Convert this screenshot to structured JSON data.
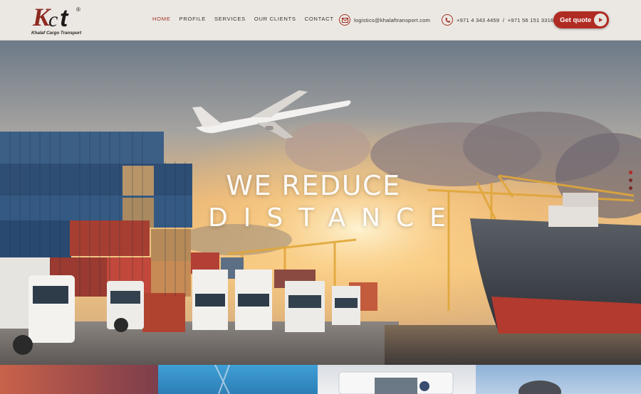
{
  "brand": {
    "logo_letters": "KCt",
    "registered_mark": "®",
    "company_name": "Khalaf Cargo Transport"
  },
  "nav": {
    "items": [
      {
        "label": "HOME",
        "active": true
      },
      {
        "label": "PROFILE",
        "active": false
      },
      {
        "label": "SERVICES",
        "active": false
      },
      {
        "label": "OUR CLIENTS",
        "active": false
      },
      {
        "label": "CONTACT",
        "active": false
      }
    ]
  },
  "contact": {
    "email_icon": "envelope-icon",
    "email": "logistics@khalaftransport.com",
    "phone_icon": "phone-icon",
    "phones": "+971 4 343 4459  /  +971 56 151 3316"
  },
  "cta": {
    "label": "Get quote",
    "icon": "play-arrow-icon"
  },
  "hero": {
    "headline_line1": "WE REDUCE",
    "headline_line2": "DISTANCE",
    "slides": [
      {
        "active": true
      },
      {
        "active": false
      },
      {
        "active": false
      }
    ]
  },
  "colors": {
    "accent": "#a23227",
    "button": "#b02b22",
    "header_bg": "#ebe8e3"
  }
}
